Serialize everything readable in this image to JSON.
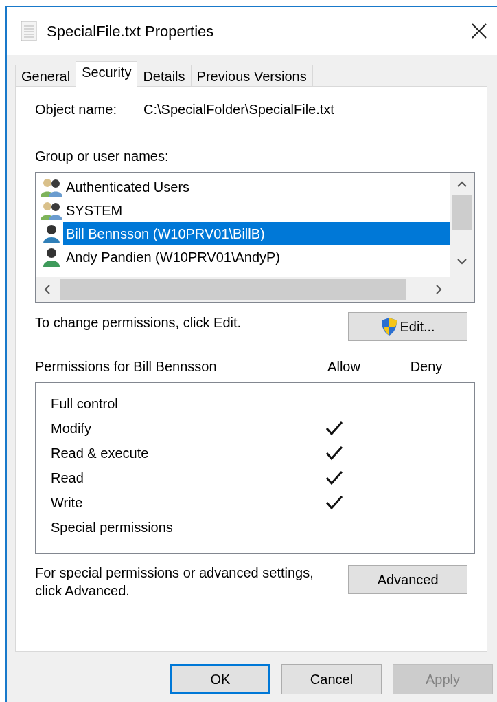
{
  "window": {
    "title": "SpecialFile.txt Properties"
  },
  "tabs": [
    {
      "label": "General",
      "selected": false
    },
    {
      "label": "Security",
      "selected": true
    },
    {
      "label": "Details",
      "selected": false
    },
    {
      "label": "Previous Versions",
      "selected": false
    }
  ],
  "object_name": {
    "label": "Object name:",
    "value": "C:\\SpecialFolder\\SpecialFile.txt"
  },
  "group_label": "Group or user names:",
  "users": [
    {
      "name": "Authenticated Users",
      "kind": "group",
      "selected": false
    },
    {
      "name": "SYSTEM",
      "kind": "group",
      "selected": false
    },
    {
      "name": "Bill Bennsson (W10PRV01\\BillB)",
      "kind": "user",
      "color": "#2f7fb8",
      "selected": true
    },
    {
      "name": "Andy Pandien (W10PRV01\\AndyP)",
      "kind": "user",
      "color": "#3e9a5a",
      "selected": false
    }
  ],
  "change_hint": "To change permissions, click Edit.",
  "edit_button": "Edit...",
  "permissions": {
    "title": "Permissions for Bill Bennsson",
    "columns": [
      "Allow",
      "Deny"
    ],
    "rows": [
      {
        "name": "Full control",
        "allow": false,
        "deny": false
      },
      {
        "name": "Modify",
        "allow": true,
        "deny": false
      },
      {
        "name": "Read & execute",
        "allow": true,
        "deny": false
      },
      {
        "name": "Read",
        "allow": true,
        "deny": false
      },
      {
        "name": "Write",
        "allow": true,
        "deny": false
      },
      {
        "name": "Special permissions",
        "allow": false,
        "deny": false
      }
    ]
  },
  "advanced_hint": "For special permissions or advanced settings, click Advanced.",
  "advanced_button": "Advanced",
  "buttons": [
    {
      "label": "OK",
      "default": true,
      "disabled": false
    },
    {
      "label": "Cancel",
      "default": false,
      "disabled": false
    },
    {
      "label": "Apply",
      "default": false,
      "disabled": true
    }
  ]
}
